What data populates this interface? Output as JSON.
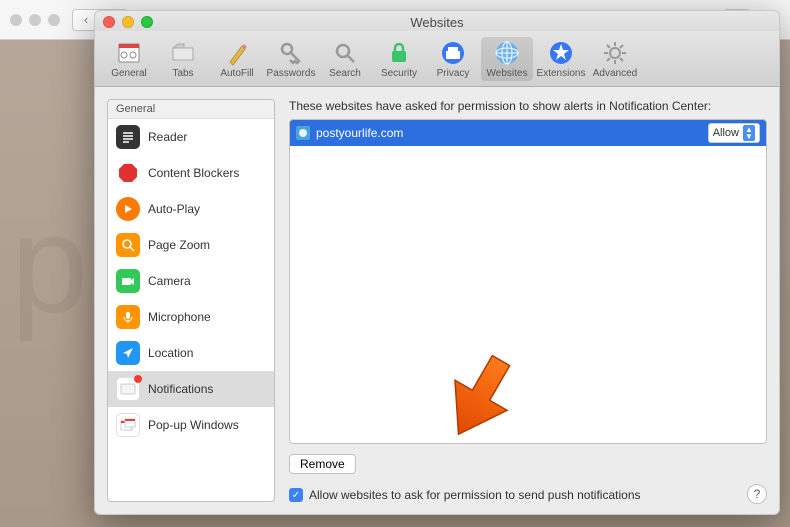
{
  "window": {
    "title": "Websites"
  },
  "toolbar": {
    "items": [
      {
        "label": "General"
      },
      {
        "label": "Tabs"
      },
      {
        "label": "AutoFill"
      },
      {
        "label": "Passwords"
      },
      {
        "label": "Search"
      },
      {
        "label": "Security"
      },
      {
        "label": "Privacy"
      },
      {
        "label": "Websites"
      },
      {
        "label": "Extensions"
      },
      {
        "label": "Advanced"
      }
    ]
  },
  "sidebar": {
    "header": "General",
    "items": [
      {
        "label": "Reader"
      },
      {
        "label": "Content Blockers"
      },
      {
        "label": "Auto-Play"
      },
      {
        "label": "Page Zoom"
      },
      {
        "label": "Camera"
      },
      {
        "label": "Microphone"
      },
      {
        "label": "Location"
      },
      {
        "label": "Notifications"
      },
      {
        "label": "Pop-up Windows"
      }
    ]
  },
  "main": {
    "heading": "These websites have asked for permission to show alerts in Notification Center:",
    "site": {
      "domain": "postyourlife.com",
      "permission": "Allow"
    },
    "remove_label": "Remove",
    "checkbox_label": "Allow websites to ask for permission to send push notifications",
    "help": "?"
  }
}
